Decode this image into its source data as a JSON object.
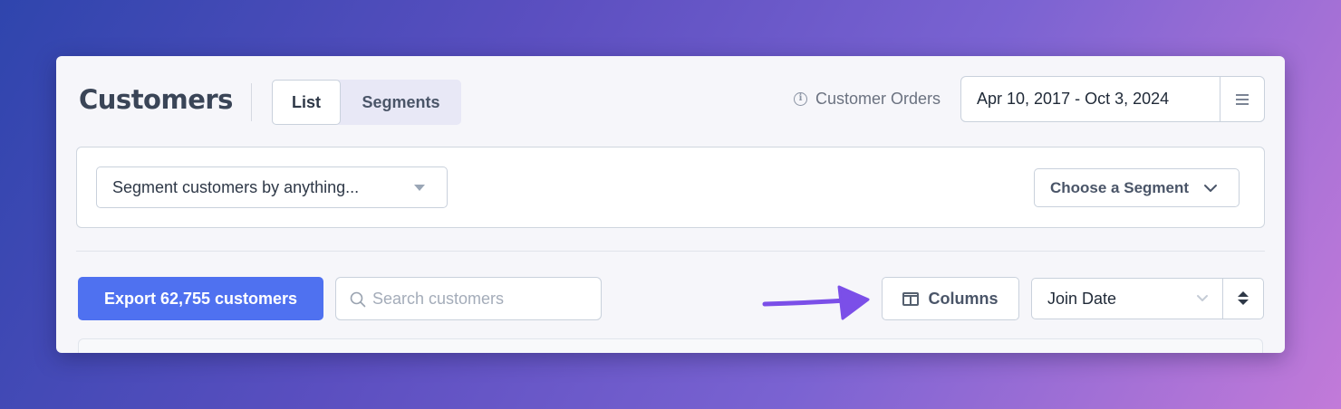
{
  "header": {
    "title": "Customers",
    "tabs": [
      {
        "label": "List",
        "active": true
      },
      {
        "label": "Segments",
        "active": false
      }
    ],
    "report_label": "Customer Orders",
    "date_range": "Apr 10, 2017 - Oct 3, 2024"
  },
  "segment_bar": {
    "filter_placeholder": "Segment customers by anything...",
    "choose_segment_label": "Choose a Segment"
  },
  "toolbar": {
    "export_label": "Export 62,755 customers",
    "search_placeholder": "Search customers",
    "columns_label": "Columns",
    "sort_field": "Join Date"
  },
  "colors": {
    "accent": "#4f71f0",
    "arrow": "#7b4fe8",
    "panel_bg": "#f6f6fa"
  },
  "icons": [
    "info-icon",
    "hamburger-icon",
    "caret-down-icon",
    "chevron-down-icon",
    "search-icon",
    "columns-icon",
    "arrow-right-icon",
    "sort-icon"
  ]
}
